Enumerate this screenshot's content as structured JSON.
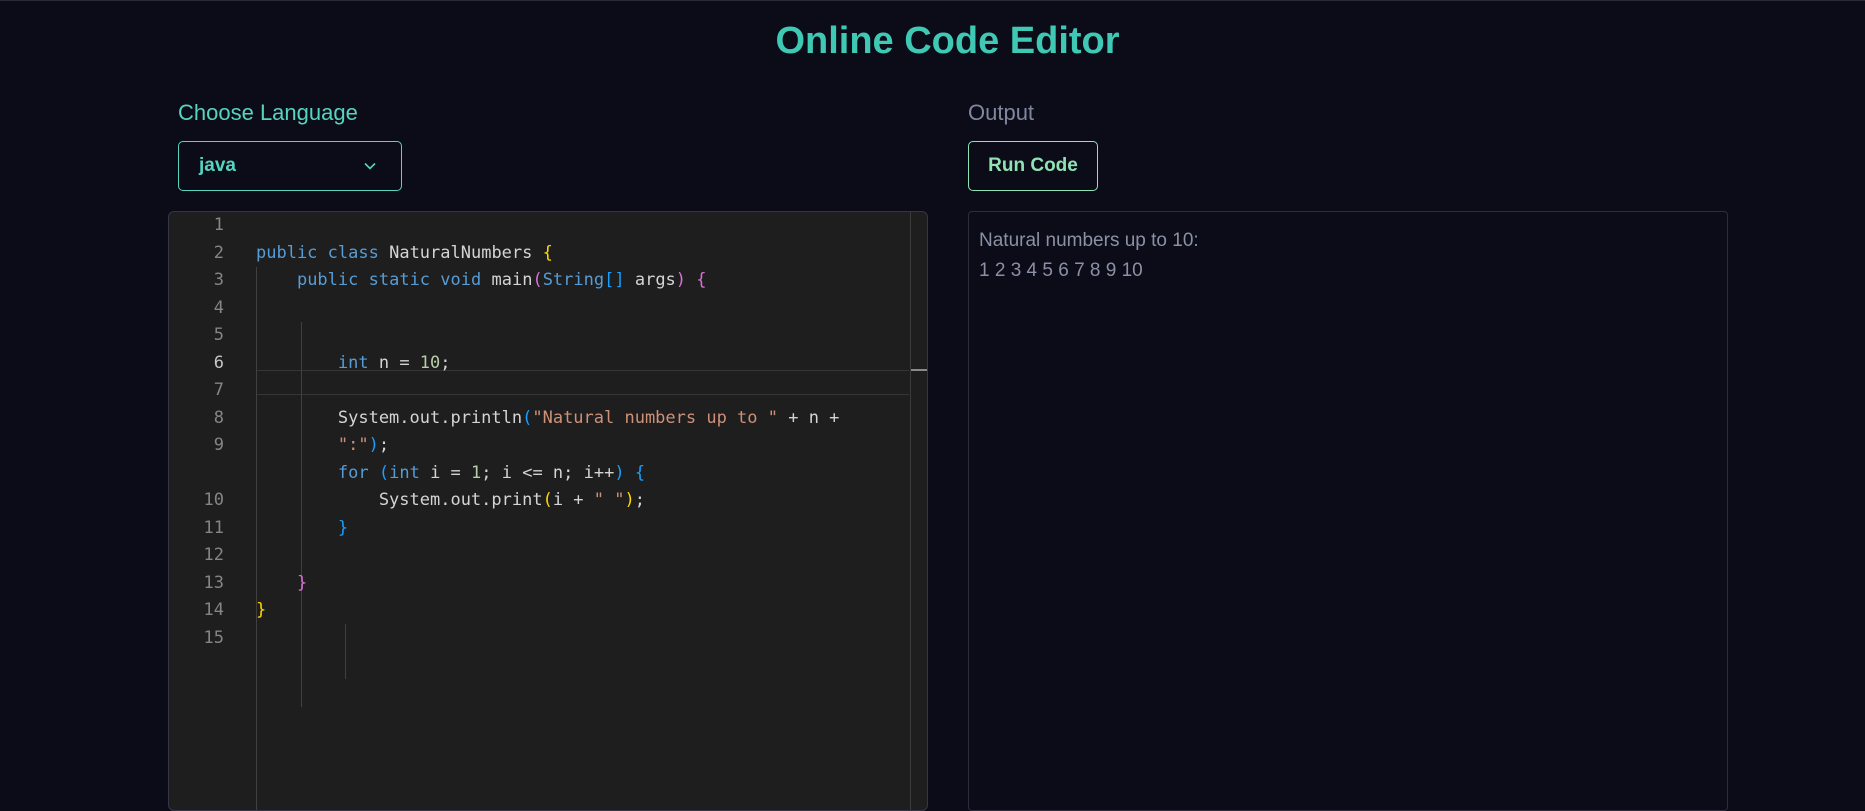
{
  "page": {
    "title": "Online Code Editor"
  },
  "language": {
    "label": "Choose Language",
    "selected": "java",
    "chevron_icon": "chevron-down-icon"
  },
  "output": {
    "label": "Output",
    "run_button": "Run Code",
    "lines": [
      "Natural numbers up to 10:",
      "1 2 3 4 5 6 7 8 9 10"
    ]
  },
  "editor": {
    "active_line": 6,
    "line_numbers": [
      "1",
      "2",
      "3",
      "4",
      "5",
      "6",
      "7",
      "8",
      "9",
      "10",
      "11",
      "12",
      "13",
      "14",
      "15"
    ],
    "code_lines": [
      "",
      "",
      "public class NaturalNumbers {",
      "    public static void main(String[] args) {",
      "",
      "",
      "        int n = 10;",
      "",
      "        System.out.println(\"Natural numbers up to \" + n +",
      "        \":\");",
      "        for (int i = 1; i <= n; i++) {",
      "            System.out.print(i + \" \");",
      "        }",
      "",
      "    }",
      "}"
    ]
  },
  "colors": {
    "background": "#0c0b18",
    "accent": "#3fc9b4",
    "run_button": "#8ee3b4",
    "editor_bg": "#1e1e1e"
  }
}
